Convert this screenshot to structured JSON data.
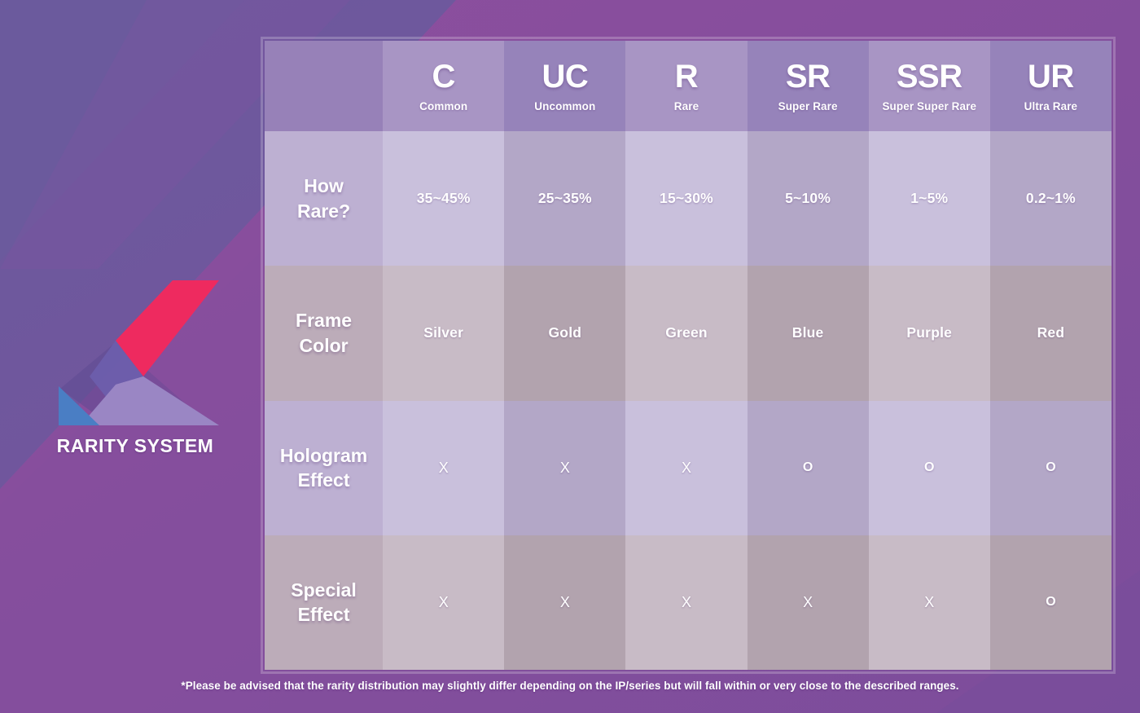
{
  "brand": {
    "title": "RARITY SYSTEM",
    "logo_icon": "k-mark-logo-icon",
    "colors": {
      "pink": "#ee2a5f",
      "light_purple": "#9a86c4",
      "blue": "#4a7ec4",
      "bg_dark": "#6e5a9e",
      "bg_light": "#8d4e9c"
    }
  },
  "table": {
    "columns": [
      {
        "code": "C",
        "name": "Common"
      },
      {
        "code": "UC",
        "name": "Uncommon"
      },
      {
        "code": "R",
        "name": "Rare"
      },
      {
        "code": "SR",
        "name": "Super Rare"
      },
      {
        "code": "SSR",
        "name": "Super Super Rare"
      },
      {
        "code": "UR",
        "name": "Ultra Rare"
      }
    ],
    "rows": [
      {
        "label_line1": "How",
        "label_line2": "Rare?",
        "cells": [
          "35~45%",
          "25~35%",
          "15~30%",
          "5~10%",
          "1~5%",
          "0.2~1%"
        ],
        "kind": "value"
      },
      {
        "label_line1": "Frame",
        "label_line2": "Color",
        "cells": [
          "Silver",
          "Gold",
          "Green",
          "Blue",
          "Purple",
          "Red"
        ],
        "kind": "value"
      },
      {
        "label_line1": "Hologram",
        "label_line2": "Effect",
        "cells": [
          "X",
          "X",
          "X",
          "O",
          "O",
          "O"
        ],
        "kind": "mark"
      },
      {
        "label_line1": "Special",
        "label_line2": "Effect",
        "cells": [
          "X",
          "X",
          "X",
          "X",
          "X",
          "O"
        ],
        "kind": "mark"
      }
    ]
  },
  "footnote": {
    "text": "*Please be advised that the rarity distribution may slightly differ depending on the IP/series but will fall within or very close to the described ranges."
  },
  "chart_data": {
    "type": "table",
    "title": "RARITY SYSTEM",
    "categories": [
      "C",
      "UC",
      "R",
      "SR",
      "SSR",
      "UR"
    ],
    "category_names": [
      "Common",
      "Uncommon",
      "Rare",
      "Super Rare",
      "Super Super Rare",
      "Ultra Rare"
    ],
    "series": [
      {
        "name": "How Rare?",
        "values": [
          "35~45%",
          "25~35%",
          "15~30%",
          "5~10%",
          "1~5%",
          "0.2~1%"
        ]
      },
      {
        "name": "Frame Color",
        "values": [
          "Silver",
          "Gold",
          "Green",
          "Blue",
          "Purple",
          "Red"
        ]
      },
      {
        "name": "Hologram Effect",
        "values": [
          "X",
          "X",
          "X",
          "O",
          "O",
          "O"
        ]
      },
      {
        "name": "Special Effect",
        "values": [
          "X",
          "X",
          "X",
          "X",
          "X",
          "O"
        ]
      }
    ],
    "rarity_percent_ranges": [
      {
        "code": "C",
        "min": 35,
        "max": 45
      },
      {
        "code": "UC",
        "min": 25,
        "max": 35
      },
      {
        "code": "R",
        "min": 15,
        "max": 30
      },
      {
        "code": "SR",
        "min": 5,
        "max": 10
      },
      {
        "code": "SSR",
        "min": 1,
        "max": 5
      },
      {
        "code": "UR",
        "min": 0.2,
        "max": 1
      }
    ],
    "notes": "*Please be advised that the rarity distribution may slightly differ depending on the IP/series but will fall within or very close to the described ranges."
  }
}
